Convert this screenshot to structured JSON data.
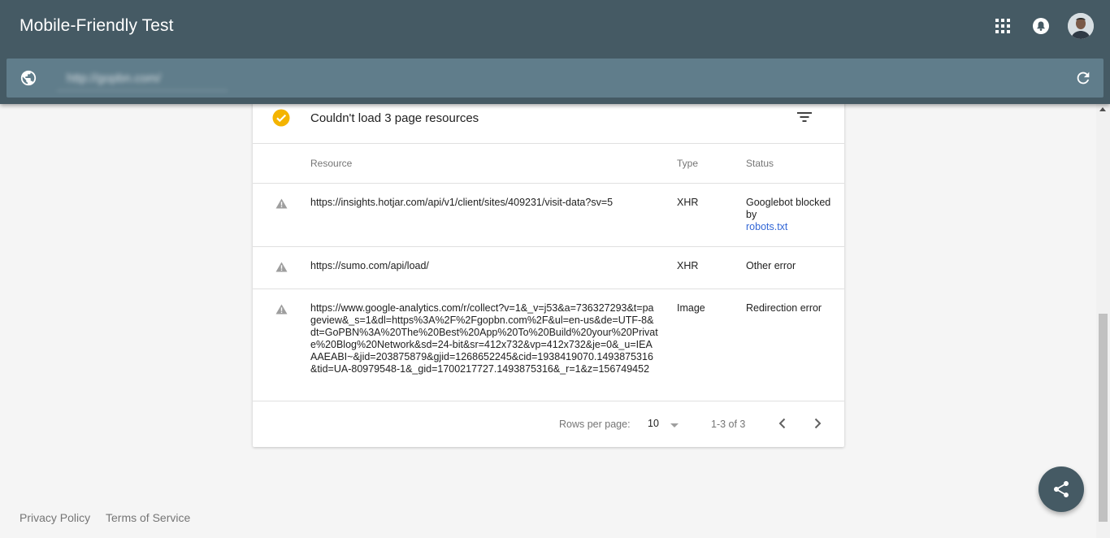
{
  "header": {
    "title": "Mobile-Friendly Test",
    "url_value": "http://gopbn.com/"
  },
  "icons": {
    "apps": "apps-grid-icon",
    "notifications": "bell-icon",
    "globe": "globe-icon",
    "refresh": "refresh-icon",
    "check": "check-circle-icon",
    "filter": "filter-icon",
    "warning": "warning-icon",
    "share": "share-icon"
  },
  "colors": {
    "header_bg": "#455a64",
    "url_bar_bg": "#607d8b",
    "check": "#f4b400",
    "link": "#3367d6"
  },
  "card": {
    "title": "Couldn't load 3 page resources",
    "columns": {
      "resource": "Resource",
      "type": "Type",
      "status": "Status"
    },
    "rows": [
      {
        "resource": "https://insights.hotjar.com/api/v1/client/sites/409231/visit-data?sv=5",
        "type": "XHR",
        "status_prefix": "Googlebot blocked by",
        "status_link": "robots.txt"
      },
      {
        "resource": "https://sumo.com/api/load/",
        "type": "XHR",
        "status": "Other error"
      },
      {
        "resource": "https://www.google-analytics.com/r/collect?v=1&_v=j53&a=736327293&t=pageview&_s=1&dl=https%3A%2F%2Fgopbn.com%2F&ul=en-us&de=UTF-8&dt=GoPBN%3A%20The%20Best%20App%20To%20Build%20your%20Private%20Blog%20Network&sd=24-bit&sr=412x732&vp=412x732&je=0&_u=IEAAAEABI~&jid=203875879&gjid=1268652245&cid=1938419070.1493875316&tid=UA-80979548-1&_gid=1700217727.1493875316&_r=1&z=156749452",
        "type": "Image",
        "status": "Redirection error"
      }
    ],
    "pagination": {
      "rows_per_page_label": "Rows per page:",
      "rows_per_page_value": "10",
      "range": "1-3 of 3"
    }
  },
  "footer": {
    "privacy": "Privacy Policy",
    "terms": "Terms of Service"
  }
}
